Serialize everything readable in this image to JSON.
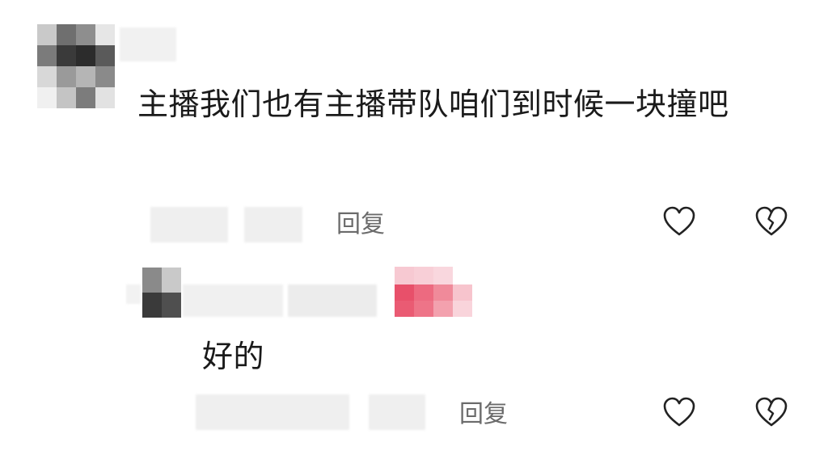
{
  "comment": {
    "text": "主播我们也有主播带队咱们到时候一块撞吧",
    "reply_label": "回复",
    "like_icon": "heart-outline-icon",
    "dislike_icon": "broken-heart-outline-icon"
  },
  "reply": {
    "text": "好的",
    "reply_label": "回复",
    "like_icon": "heart-outline-icon",
    "dislike_icon": "broken-heart-outline-icon"
  },
  "colors": {
    "text": "#1a1a1a",
    "meta": "#6b6b6b",
    "icon_stroke": "#222222",
    "author_badge": "#e8506a"
  }
}
